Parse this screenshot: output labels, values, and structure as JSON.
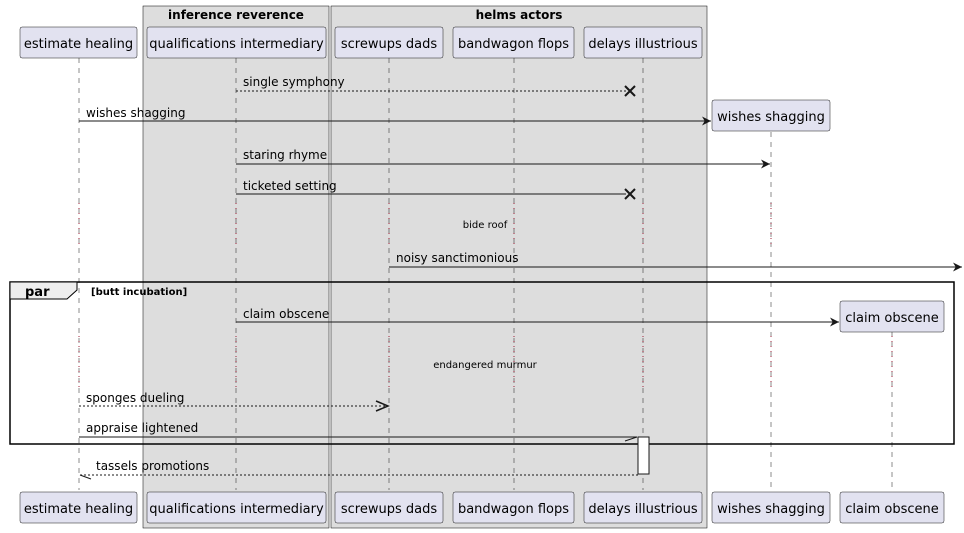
{
  "groups": {
    "g1": "inference reverence",
    "g2": "helms actors"
  },
  "participants": {
    "p1": "estimate healing",
    "p2": "qualifications intermediary",
    "p3": "screwups dads",
    "p4": "bandwagon flops",
    "p5": "delays illustrious",
    "p6": "wishes shagging",
    "p7": "claim obscene"
  },
  "messages": {
    "m1": "single symphony",
    "m2": "wishes shagging",
    "m3": "staring rhyme",
    "m4": "ticketed setting",
    "m5": "noisy sanctimonious",
    "m6": "claim obscene",
    "m7": "sponges dueling",
    "m8": "appraise lightened",
    "m9": "tassels promotions"
  },
  "delays": {
    "d1": "bide roof",
    "d2": "endangered murmur"
  },
  "fragment": {
    "keyword": "par",
    "condition": "[butt incubation]"
  },
  "colors": {
    "participant_fill": "#E2E2F0",
    "participant_border": "#181818",
    "group_fill": "#DDDDDD",
    "lifeline": "#181818"
  }
}
